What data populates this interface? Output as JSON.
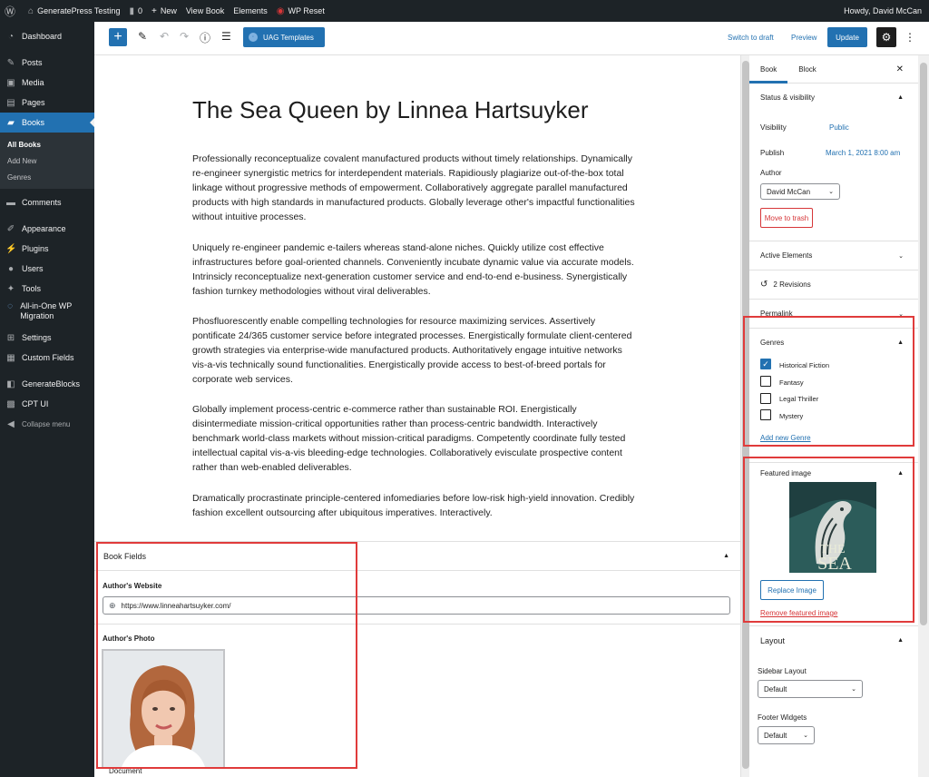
{
  "admin_bar": {
    "site_name": "GeneratePress Testing",
    "comments_count": "0",
    "new_label": "New",
    "view_label": "View Book",
    "elements_label": "Elements",
    "wp_reset_label": "WP Reset",
    "howdy": "Howdy, David McCan"
  },
  "admin_menu": {
    "dashboard": "Dashboard",
    "posts": "Posts",
    "media": "Media",
    "pages": "Pages",
    "books": "Books",
    "all_books": "All Books",
    "add_new": "Add New",
    "genres": "Genres",
    "comments": "Comments",
    "appearance": "Appearance",
    "plugins": "Plugins",
    "users": "Users",
    "tools": "Tools",
    "all_in_one": "All-in-One WP Migration",
    "settings": "Settings",
    "custom_fields": "Custom Fields",
    "generateblocks": "GenerateBlocks",
    "cpt_ui": "CPT UI",
    "collapse": "Collapse menu"
  },
  "toolbar": {
    "uag_label": "UAG Templates",
    "switch_draft": "Switch to draft",
    "preview": "Preview",
    "update": "Update"
  },
  "post": {
    "title": "The Sea Queen by Linnea Hartsuyker",
    "paragraphs": [
      "Professionally reconceptualize covalent manufactured products without timely relationships. Dynamically re-engineer synergistic metrics for interdependent materials. Rapidiously plagiarize out-of-the-box total linkage without progressive methods of empowerment. Collaboratively aggregate parallel manufactured products with high standards in manufactured products. Globally leverage other's impactful functionalities without intuitive processes.",
      "Uniquely re-engineer pandemic e-tailers whereas stand-alone niches. Quickly utilize cost effective infrastructures before goal-oriented channels. Conveniently incubate dynamic value via accurate models. Intrinsicly reconceptualize next-generation customer service and end-to-end e-business. Synergistically fashion turnkey methodologies without viral deliverables.",
      "Phosfluorescently enable compelling technologies for resource maximizing services. Assertively pontificate 24/365 customer service before integrated processes. Energistically formulate client-centered growth strategies via enterprise-wide manufactured products. Authoritatively engage intuitive networks vis-a-vis technically sound functionalities. Energistically provide access to best-of-breed portals for corporate web services.",
      "Globally implement process-centric e-commerce rather than sustainable ROI. Energistically disintermediate mission-critical opportunities rather than process-centric bandwidth. Interactively benchmark world-class markets without mission-critical paradigms. Competently coordinate fully tested intellectual capital vis-a-vis bleeding-edge technologies. Collaboratively evisculate prospective content rather than web-enabled deliverables.",
      "Dramatically procrastinate principle-centered infomediaries before low-risk high-yield innovation. Credibly fashion excellent outsourcing after ubiquitous imperatives. Interactively."
    ]
  },
  "book_fields": {
    "heading": "Book Fields",
    "website_label": "Author's Website",
    "website_value": "https://www.linneahartsuyker.com/",
    "photo_label": "Author's Photo",
    "document_label": "Document"
  },
  "sidebar": {
    "tab_book": "Book",
    "tab_block": "Block",
    "status_heading": "Status & visibility",
    "visibility_label": "Visibility",
    "visibility_value": "Public",
    "publish_label": "Publish",
    "publish_value": "March 1, 2021 8:00 am",
    "author_label": "Author",
    "author_value": "David McCan",
    "trash": "Move to trash",
    "active_elements": "Active Elements",
    "revisions": "2 Revisions",
    "permalink": "Permalink",
    "genres_heading": "Genres",
    "genres": [
      {
        "label": "Historical Fiction",
        "checked": true
      },
      {
        "label": "Fantasy",
        "checked": false
      },
      {
        "label": "Legal Thriller",
        "checked": false
      },
      {
        "label": "Mystery",
        "checked": false
      }
    ],
    "add_genre": "Add new Genre",
    "featured_heading": "Featured image",
    "replace_image": "Replace Image",
    "remove_image": "Remove featured image",
    "layout_heading": "Layout",
    "sidebar_layout_label": "Sidebar Layout",
    "sidebar_layout_value": "Default",
    "footer_widgets_label": "Footer Widgets",
    "footer_widgets_value": "Default"
  },
  "colors": {
    "accent": "#2271b1",
    "admin_bg": "#1d2327",
    "highlight": "#e03b3b",
    "danger": "#d63638"
  }
}
